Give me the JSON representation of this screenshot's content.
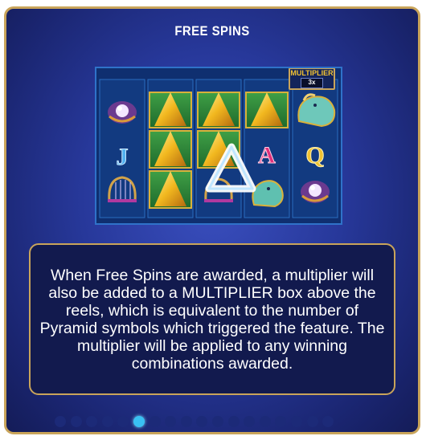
{
  "title": "FREE SPINS",
  "multiplier": {
    "label": "MULTIPLIER",
    "value": "3x"
  },
  "reels": [
    [
      "pearl-shell",
      "letter-j",
      "harp"
    ],
    [
      "pyramid",
      "pyramid",
      "pyramid"
    ],
    [
      "pyramid",
      "pyramid",
      "triangle-symbol"
    ],
    [
      "pyramid",
      "letter-a",
      "seahorse"
    ],
    [
      "seahorse",
      "letter-q",
      "pearl-shell"
    ]
  ],
  "description": "When Free Spins are awarded, a multiplier will also be added to a MULTIPLIER box above the reels, which is equivalent to the number of Pyramid symbols which triggered the feature. The multiplier will be applied to any winning combinations awarded.",
  "pagination": {
    "total": 18,
    "active_index": 5
  },
  "colors": {
    "accent": "#39c0f3",
    "border": "#c9a45a",
    "panel": "#27389a",
    "gold": "#f1c232"
  }
}
